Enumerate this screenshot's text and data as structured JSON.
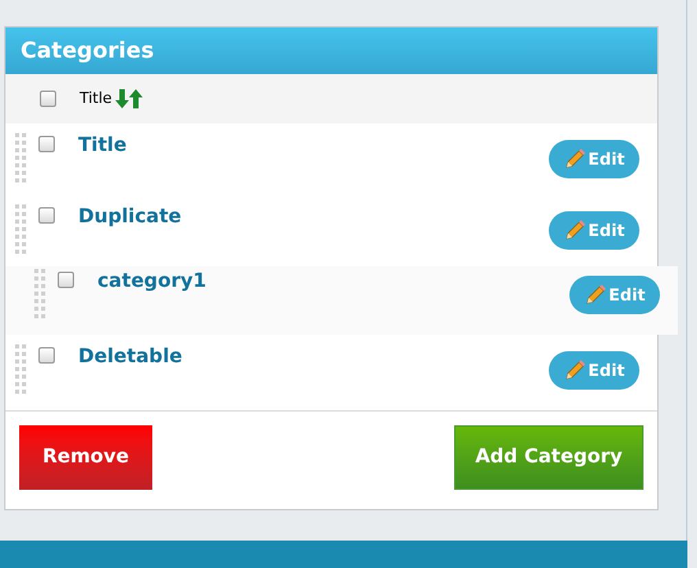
{
  "panel": {
    "title": "Categories"
  },
  "header": {
    "checked": false,
    "column": "Title"
  },
  "categories": [
    {
      "title": "Title",
      "checked": false,
      "action": "Edit"
    },
    {
      "title": "Duplicate",
      "checked": false,
      "action": "Edit",
      "children": [
        {
          "title": "category1",
          "checked": false,
          "action": "Edit"
        }
      ]
    },
    {
      "title": "Deletable",
      "checked": false,
      "action": "Edit"
    }
  ],
  "buttons": [
    {
      "label": "Remove",
      "kind": "danger"
    },
    {
      "label": "Add Category",
      "kind": "primary"
    }
  ]
}
